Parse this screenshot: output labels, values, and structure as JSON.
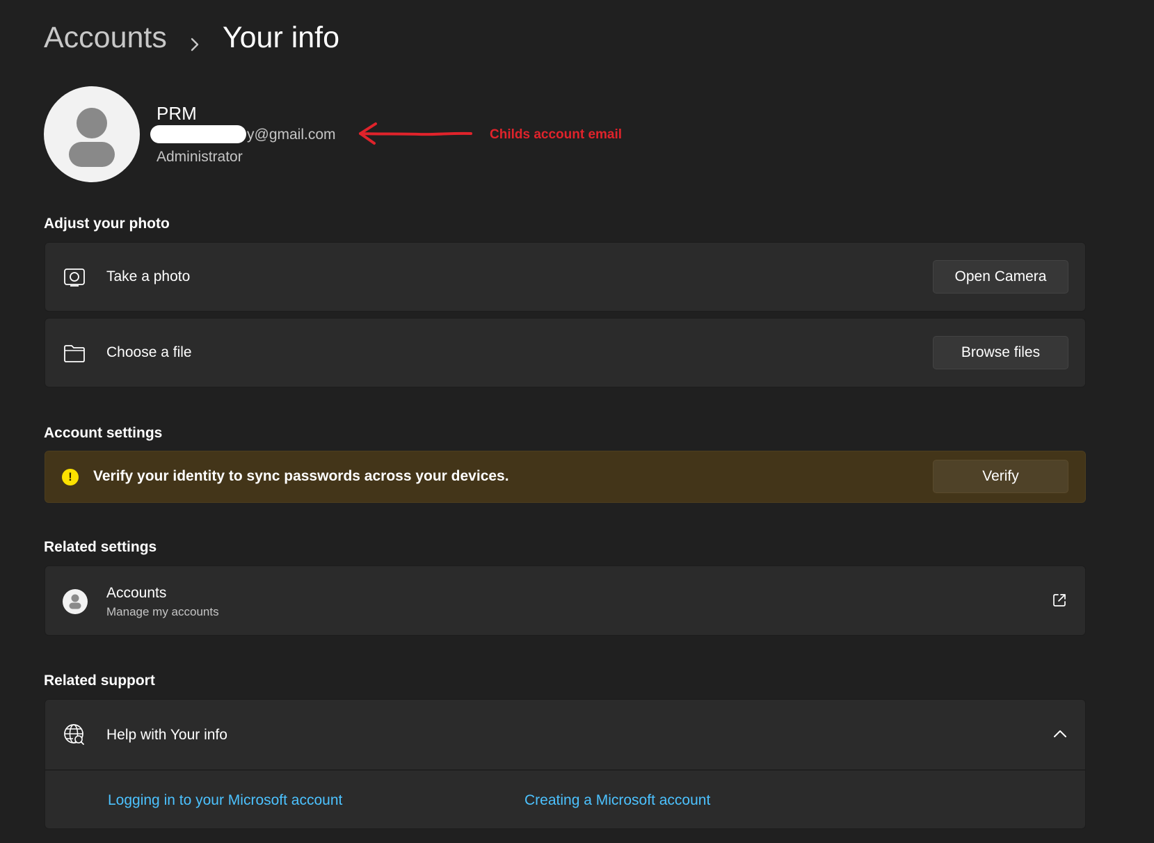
{
  "breadcrumb": {
    "parent": "Accounts",
    "current": "Your info"
  },
  "profile": {
    "name": "PRM",
    "email_visible": "y@gmail.com",
    "role": "Administrator"
  },
  "annotation": {
    "text": "Childs account email",
    "color": "#e0232b"
  },
  "photo_section": {
    "title": "Adjust your photo",
    "rows": [
      {
        "icon": "camera-icon",
        "label": "Take a photo",
        "button": "Open Camera"
      },
      {
        "icon": "folder-icon",
        "label": "Choose a file",
        "button": "Browse files"
      }
    ]
  },
  "account_settings": {
    "title": "Account settings",
    "warning_icon": "warning-icon",
    "warning_text": "Verify your identity to sync passwords across your devices.",
    "button": "Verify"
  },
  "related_settings": {
    "title": "Related settings",
    "item": {
      "icon": "account-icon",
      "label": "Accounts",
      "sublabel": "Manage my accounts",
      "action_icon": "external-link-icon"
    }
  },
  "related_support": {
    "title": "Related support",
    "help": {
      "icon": "globe-help-icon",
      "label": "Help with Your info",
      "expander_icon": "chevron-up-icon",
      "links": [
        "Logging in to your Microsoft account",
        "Creating a Microsoft account"
      ]
    }
  },
  "colors": {
    "background": "#202020",
    "card": "#2b2b2b",
    "warning_card": "#433519",
    "warning_icon": "#fce100",
    "link": "#4cc2ff"
  }
}
